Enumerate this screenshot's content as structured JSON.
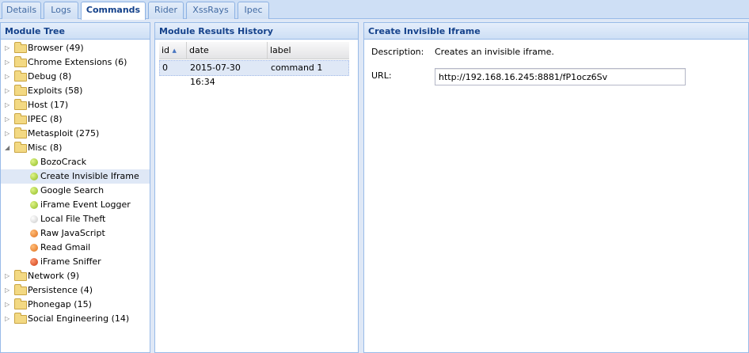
{
  "tabs": [
    {
      "label": "Details",
      "active": false
    },
    {
      "label": "Logs",
      "active": false
    },
    {
      "label": "Commands",
      "active": true
    },
    {
      "label": "Rider",
      "active": false
    },
    {
      "label": "XssRays",
      "active": false
    },
    {
      "label": "Ipec",
      "active": false
    }
  ],
  "module_tree": {
    "title": "Module Tree",
    "nodes": [
      {
        "label": "Browser (49)",
        "type": "folder",
        "expanded": false
      },
      {
        "label": "Chrome Extensions (6)",
        "type": "folder",
        "expanded": false
      },
      {
        "label": "Debug (8)",
        "type": "folder",
        "expanded": false
      },
      {
        "label": "Exploits (58)",
        "type": "folder",
        "expanded": false
      },
      {
        "label": "Host (17)",
        "type": "folder",
        "expanded": false
      },
      {
        "label": "IPEC (8)",
        "type": "folder",
        "expanded": false
      },
      {
        "label": "Metasploit (275)",
        "type": "folder",
        "expanded": false
      },
      {
        "label": "Misc (8)",
        "type": "folder",
        "expanded": true
      },
      {
        "label": "BozoCrack",
        "type": "module",
        "status": "green"
      },
      {
        "label": "Create Invisible Iframe",
        "type": "module",
        "status": "green",
        "selected": true
      },
      {
        "label": "Google Search",
        "type": "module",
        "status": "green"
      },
      {
        "label": "iFrame Event Logger",
        "type": "module",
        "status": "green"
      },
      {
        "label": "Local File Theft",
        "type": "module",
        "status": "grey"
      },
      {
        "label": "Raw JavaScript",
        "type": "module",
        "status": "orange"
      },
      {
        "label": "Read Gmail",
        "type": "module",
        "status": "orange"
      },
      {
        "label": "iFrame Sniffer",
        "type": "module",
        "status": "red"
      },
      {
        "label": "Network (9)",
        "type": "folder",
        "expanded": false
      },
      {
        "label": "Persistence (4)",
        "type": "folder",
        "expanded": false
      },
      {
        "label": "Phonegap (15)",
        "type": "folder",
        "expanded": false
      },
      {
        "label": "Social Engineering (14)",
        "type": "folder",
        "expanded": false
      }
    ]
  },
  "results_history": {
    "title": "Module Results History",
    "columns": {
      "id": "id",
      "date": "date",
      "label": "label"
    },
    "sort_indicator": "▲",
    "rows": [
      {
        "id": "0",
        "date": "2015-07-30 16:34",
        "label": "command 1"
      }
    ]
  },
  "module_detail": {
    "title": "Create Invisible Iframe",
    "description_label": "Description:",
    "description_value": "Creates an invisible iframe.",
    "url_label": "URL:",
    "url_value": "http://192.168.16.245:8881/fP1ocz6Sv"
  },
  "colors": {
    "header_text": "#15428b",
    "border": "#99bbe8",
    "selection": "#dfe8f6"
  }
}
